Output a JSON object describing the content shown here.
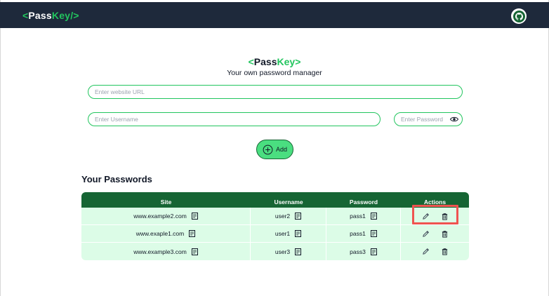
{
  "navbar": {
    "logo_left": "<",
    "logo_pass": "Pass",
    "logo_key": "Key",
    "logo_right": "/>",
    "github_icon": "github-icon"
  },
  "hero": {
    "brand_left": "<",
    "brand_pass": "Pass",
    "brand_key": "Key",
    "brand_right": ">",
    "tagline": "Your own password manager"
  },
  "form": {
    "url_placeholder": "Enter website URL",
    "username_placeholder": "Enter Username",
    "password_placeholder": "Enter Password",
    "add_label": "Add"
  },
  "passwords": {
    "title": "Your Passwords",
    "columns": [
      "Site",
      "Username",
      "Password",
      "Actions"
    ],
    "rows": [
      {
        "site": "www.example2.com",
        "username": "user2",
        "password": "pass1"
      },
      {
        "site": "www.exaple1.com",
        "username": "user1",
        "password": "pass1"
      },
      {
        "site": "www.example3.com",
        "username": "user3",
        "password": "pass3"
      }
    ]
  },
  "colors": {
    "navbar_bg": "#1e293b",
    "accent": "#22c55e",
    "table_header": "#166534",
    "row_bg": "#dcfce7",
    "highlight": "#ef5350"
  }
}
